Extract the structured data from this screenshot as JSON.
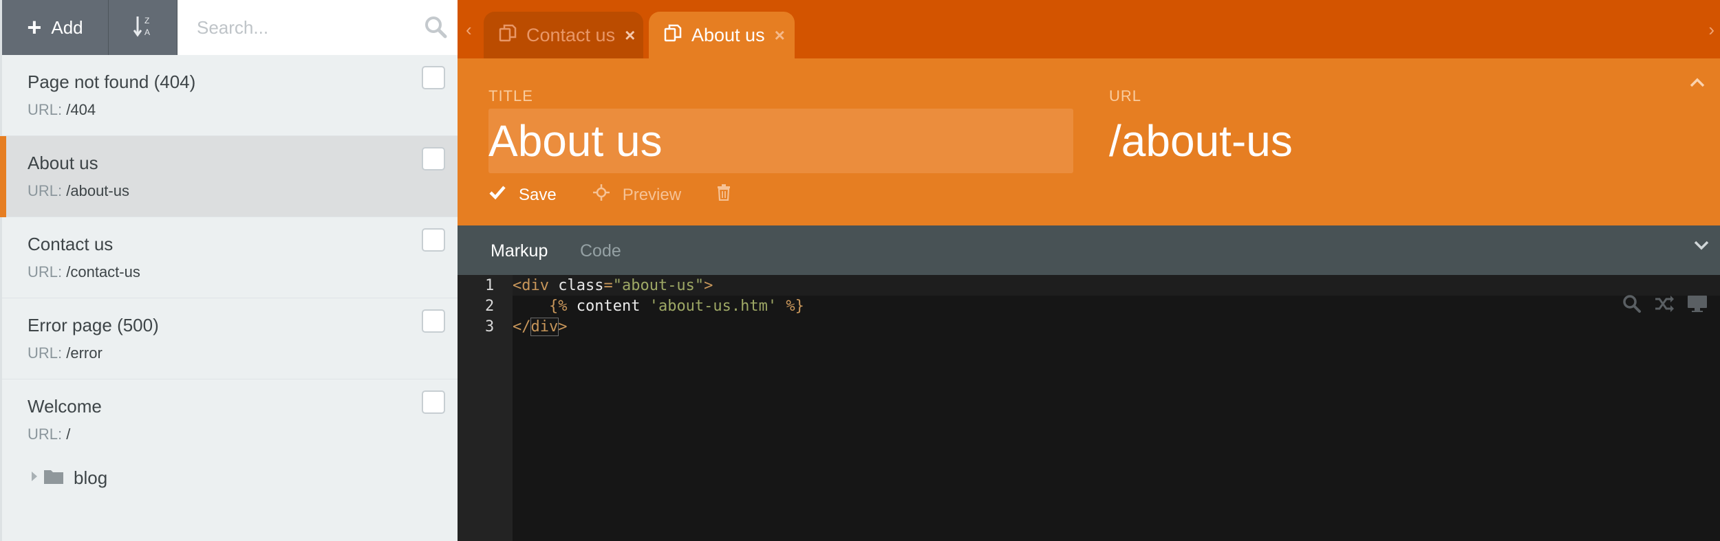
{
  "sidebar": {
    "toolbar": {
      "add_label": "Add",
      "sort_icon": "sort-alpha-icon",
      "sort_letters": {
        "top": "Z",
        "bottom": "A"
      }
    },
    "search": {
      "placeholder": "Search..."
    },
    "url_prefix": "URL:",
    "items": [
      {
        "title": "Page not found (404)",
        "url": "/404",
        "active": false
      },
      {
        "title": "About us",
        "url": "/about-us",
        "active": true
      },
      {
        "title": "Contact us",
        "url": "/contact-us",
        "active": false
      },
      {
        "title": "Error page (500)",
        "url": "/error",
        "active": false
      },
      {
        "title": "Welcome",
        "url": "/",
        "active": false
      }
    ],
    "folder": {
      "label": "blog"
    }
  },
  "tabs": [
    {
      "label": "Contact us",
      "active": false
    },
    {
      "label": "About us",
      "active": true
    }
  ],
  "form": {
    "title_label": "TITLE",
    "title_value": "About us",
    "url_label": "URL",
    "url_value": "/about-us",
    "save_label": "Save",
    "preview_label": "Preview"
  },
  "editor": {
    "tabs": [
      {
        "label": "Markup",
        "active": true
      },
      {
        "label": "Code",
        "active": false
      }
    ],
    "line_numbers": [
      "1",
      "2",
      "3"
    ],
    "lines": {
      "l1": {
        "open": "<div",
        "attr": " class",
        "eq": "=",
        "str": "\"about-us\"",
        "close": ">"
      },
      "l2": {
        "indent": "    ",
        "t1": "{%",
        "kw": " content ",
        "str": "'about-us.htm'",
        "t2": " %}"
      },
      "l3": {
        "open": "</",
        "tag": "div",
        "close": ">"
      }
    }
  },
  "colors": {
    "accent": "#e67e22",
    "tabbar": "#d35400",
    "sidebar_bg": "#ecf0f1",
    "editor_bg": "#161616",
    "editor_tabs_bg": "#485255"
  }
}
